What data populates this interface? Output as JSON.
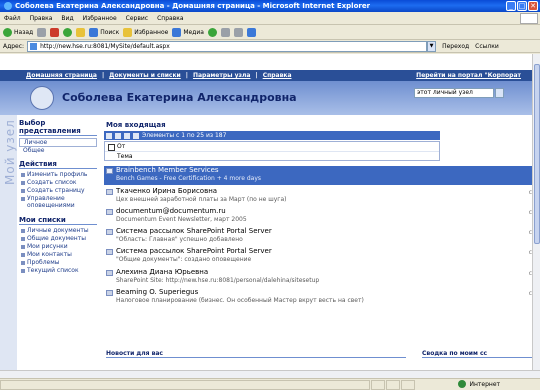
{
  "window": {
    "title": "Соболева Екатерина Александровна - Домашняя страница - Microsoft Internet Explorer",
    "buttons": [
      "_",
      "□",
      "✕"
    ]
  },
  "menu": [
    "Файл",
    "Правка",
    "Вид",
    "Избранное",
    "Сервис",
    "Справка"
  ],
  "toolbar": {
    "back": "Назад",
    "search": "Поиск",
    "favorites": "Избранное",
    "media": "Медиа"
  },
  "address": {
    "label": "Адрес:",
    "url": "http://new.hse.ru:8081/MySite/default.aspx",
    "go": "Переход",
    "links": "Ссылки"
  },
  "portal": {
    "topnav": [
      "Домашняя страница",
      "Документы и списки",
      "Параметры узла",
      "Справка"
    ],
    "topnav_right": "Перейти на портал \"Корпорат",
    "user_name": "Соболева Екатерина Александровна",
    "node_select": "этот личный узел",
    "side_watermark": "Мой узел"
  },
  "left_panel": {
    "view_title": "Выбор представления",
    "view_items": [
      "Личное",
      "Общее"
    ],
    "actions_title": "Действия",
    "actions": [
      "Изменить профиль",
      "Создать список",
      "Создать страницу",
      "Управление оповещениями"
    ],
    "lists_title": "Мои списки",
    "lists": [
      "Личные документы",
      "Общие документы",
      "Мои рисунки",
      "Мои контакты",
      "Проблемы",
      "Текущий список"
    ]
  },
  "inbox": {
    "title": "Моя входящая",
    "pager": "Элементы с 1 по 25 из 187",
    "col_from": "От",
    "col_subject": "Тема",
    "messages": [
      {
        "from": "Brainbench Member Services",
        "subject": "Bench Games - Free Certification + 4 more days",
        "selected": true
      },
      {
        "from": "Ткаченко Ирина Борисовна",
        "subject": "Цех внешней заработной платы за Март (по не шуга)",
        "selected": false
      },
      {
        "from": "documentum@documentum.ru",
        "subject": "Documentum Event Newsletter, март 2005",
        "selected": false
      },
      {
        "from": "Система рассылок SharePoint Portal Server",
        "subject": "\"Область: Главная\" успешно добавлено",
        "selected": false
      },
      {
        "from": "Система рассылок SharePoint Portal Server",
        "subject": "\"Общие документы\": создано оповещение",
        "selected": false
      },
      {
        "from": "Алехина Диана Юрьевна",
        "subject": "SharePoint Site: http://new.hse.ru:8081/personal/dalehina/sitesetup",
        "selected": false
      },
      {
        "from": "Beaming O. Superiegus",
        "subject": "Налоговое планирование (бизнес. Он особенный Мастер вкрут весть на свет)",
        "selected": false
      }
    ]
  },
  "bottom": {
    "news": "Новости для вас",
    "summary": "Сводка по моим сс"
  },
  "status": {
    "zone": "Интернет"
  },
  "colors": {
    "title_bar": "#0a4bd6",
    "portal_nav": "#2a4f97",
    "selection": "#3c68c0",
    "header_band": "#6f8fd0"
  }
}
